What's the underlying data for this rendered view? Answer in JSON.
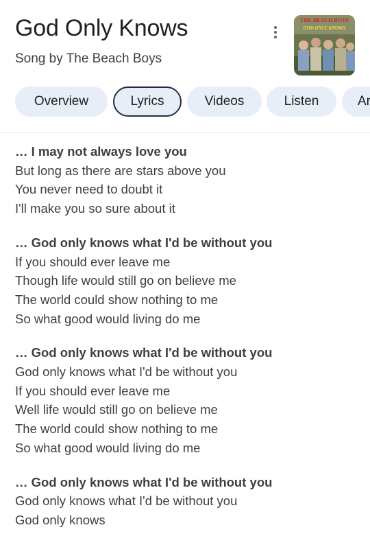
{
  "header": {
    "title": "God Only Knows",
    "subtitle": "Song by The Beach Boys",
    "cover_text_top": "THE BEACH BOYS",
    "cover_text_bottom": "GOD ONLY KNOWS"
  },
  "tabs": [
    {
      "label": "Overview"
    },
    {
      "label": "Lyrics"
    },
    {
      "label": "Videos"
    },
    {
      "label": "Listen"
    },
    {
      "label": "Ar"
    }
  ],
  "active_tab": "Lyrics",
  "lyrics": {
    "stanzas": [
      {
        "lines": [
          "… I may not always love you",
          "But long as there are stars above you",
          "You never need to doubt it",
          "I'll make you so sure about it"
        ]
      },
      {
        "lines": [
          "… God only knows what I'd be without you",
          "If you should ever leave me",
          "Though life would still go on believe me",
          "The world could show nothing to me",
          "So what good would living do me"
        ]
      },
      {
        "lines": [
          "… God only knows what I'd be without you",
          "God only knows what I'd be without you",
          "If you should ever leave me",
          "Well life would still go on believe me",
          "The world could show nothing to me",
          "So what good would living do me"
        ]
      },
      {
        "lines": [
          "… God only knows what I'd be without you",
          "God only knows what I'd be without you",
          "God only knows"
        ]
      }
    ]
  },
  "colors": {
    "tab_background": "#e8eef7",
    "active_tab_border": "#1f2f46",
    "cover_text": "#d81f26",
    "cover_text_secondary": "#f4e23a"
  }
}
